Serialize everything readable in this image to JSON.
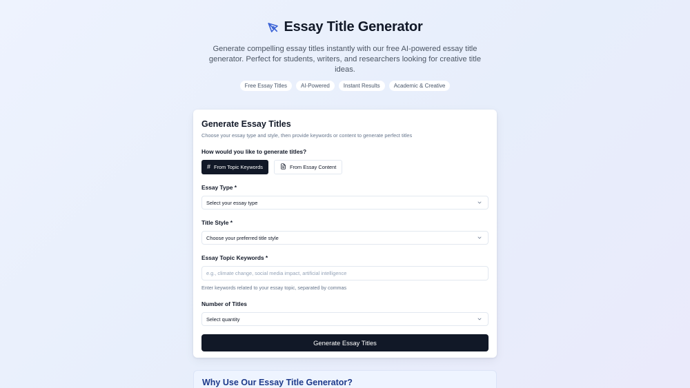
{
  "hero": {
    "title": "Essay Title Generator",
    "subtitle": "Generate compelling essay titles instantly with our free AI-powered essay title generator. Perfect for students, writers, and researchers looking for creative title ideas.",
    "chips": [
      "Free Essay Titles",
      "AI-Powered",
      "Instant Results",
      "Academic & Creative"
    ]
  },
  "form": {
    "title": "Generate Essay Titles",
    "description": "Choose your essay type and style, then provide keywords or content to generate perfect titles",
    "mode_question": "How would you like to generate titles?",
    "modes": [
      {
        "label": "From Topic Keywords",
        "icon": "#",
        "active": true
      },
      {
        "label": "From Essay Content",
        "icon": "document-icon",
        "active": false
      }
    ],
    "essay_type": {
      "label": "Essay Type *",
      "value": "Select your essay type"
    },
    "title_style": {
      "label": "Title Style *",
      "value": "Choose your preferred title style"
    },
    "keywords": {
      "label": "Essay Topic Keywords *",
      "placeholder": "e.g., climate change, social media impact, artificial intelligence",
      "hint": "Enter keywords related to your essay topic, separated by commas"
    },
    "count": {
      "label": "Number of Titles",
      "value": "Select quantity"
    },
    "submit_label": "Generate Essay Titles"
  },
  "why": {
    "title": "Why Use Our Essay Title Generator?"
  },
  "colors": {
    "primary": "#111827",
    "accent": "#1e3a8a",
    "logo": "#3b63d6"
  }
}
